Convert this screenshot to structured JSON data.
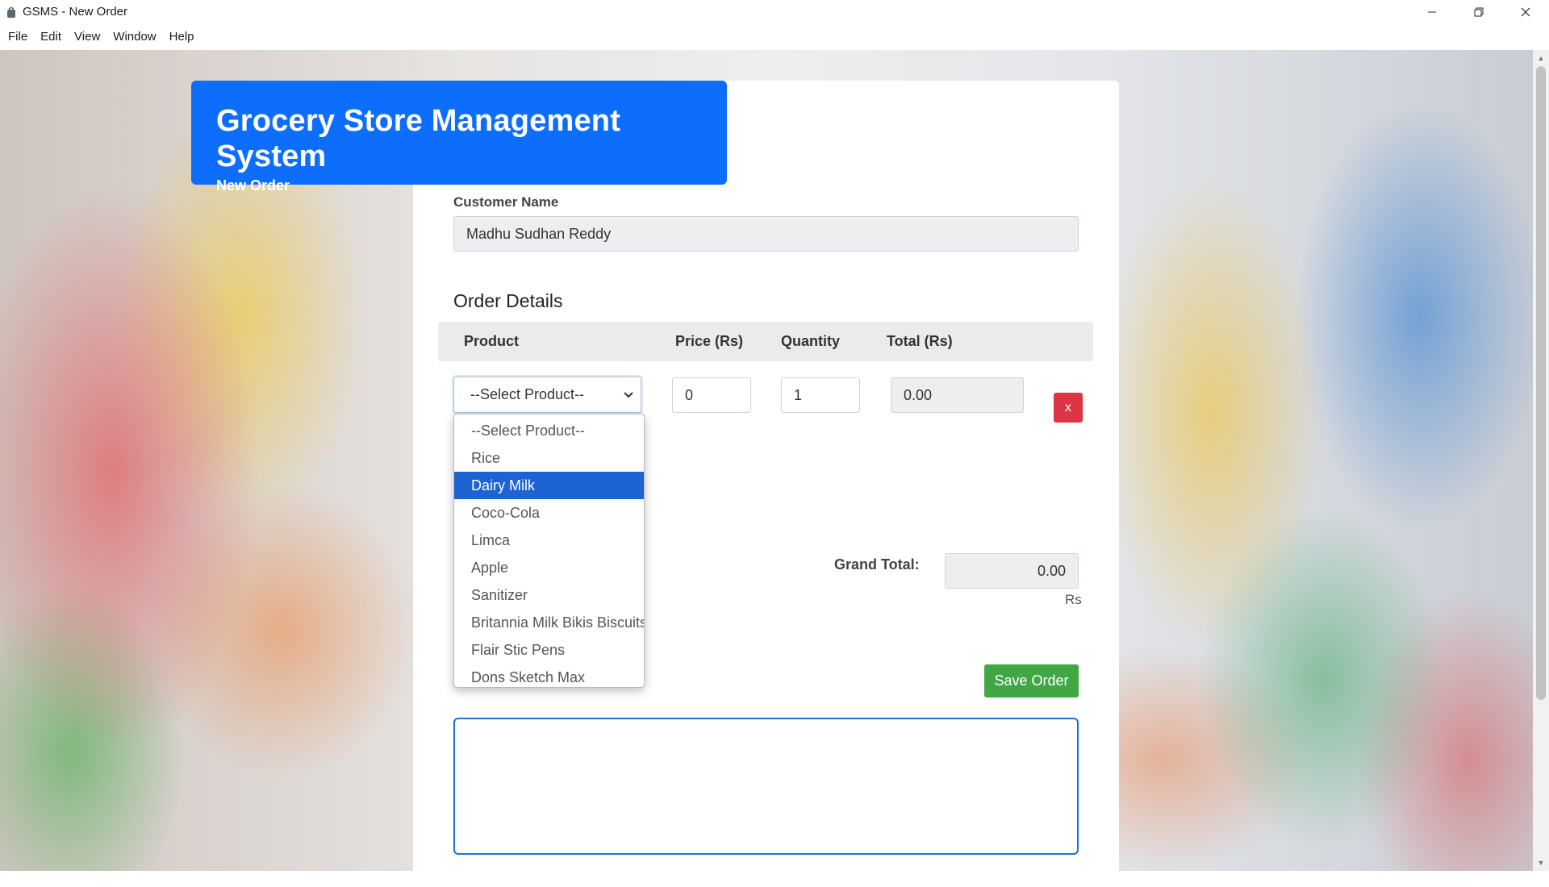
{
  "window": {
    "title": "GSMS - New Order",
    "icons": {
      "app": "grocery-app-icon",
      "minimize": "minimize-icon",
      "maximize": "restore-icon",
      "close": "close-icon"
    }
  },
  "menu": [
    "File",
    "Edit",
    "View",
    "Window",
    "Help"
  ],
  "header": {
    "title": "Grocery Store Management System",
    "subtitle": "New Order",
    "color": "#0d6efd"
  },
  "customer": {
    "label": "Customer Name",
    "value": "Madhu Sudhan Reddy"
  },
  "order": {
    "section_title": "Order Details",
    "columns": [
      "Product",
      "Price (Rs)",
      "Quantity",
      "Total (Rs)"
    ],
    "row": {
      "product": "--Select Product--",
      "price": "0",
      "quantity": "1",
      "total": "0.00",
      "remove_label": "x"
    }
  },
  "dropdown": {
    "options": [
      "--Select Product--",
      "Rice",
      "Dairy Milk",
      "Coco-Cola",
      "Limca",
      "Apple",
      "Sanitizer",
      "Britannia Milk Bikis Biscuits",
      "Flair Stic Pens",
      "Dons Sketch Max"
    ],
    "highlighted": "Dairy Milk",
    "highlight_color": "#1e63d3"
  },
  "summary": {
    "grand_total_label": "Grand Total:",
    "grand_total_value": "0.00",
    "unit": "Rs"
  },
  "actions": {
    "save_label": "Save Order",
    "save_color": "#41a745",
    "remove_color": "#dc3545"
  }
}
